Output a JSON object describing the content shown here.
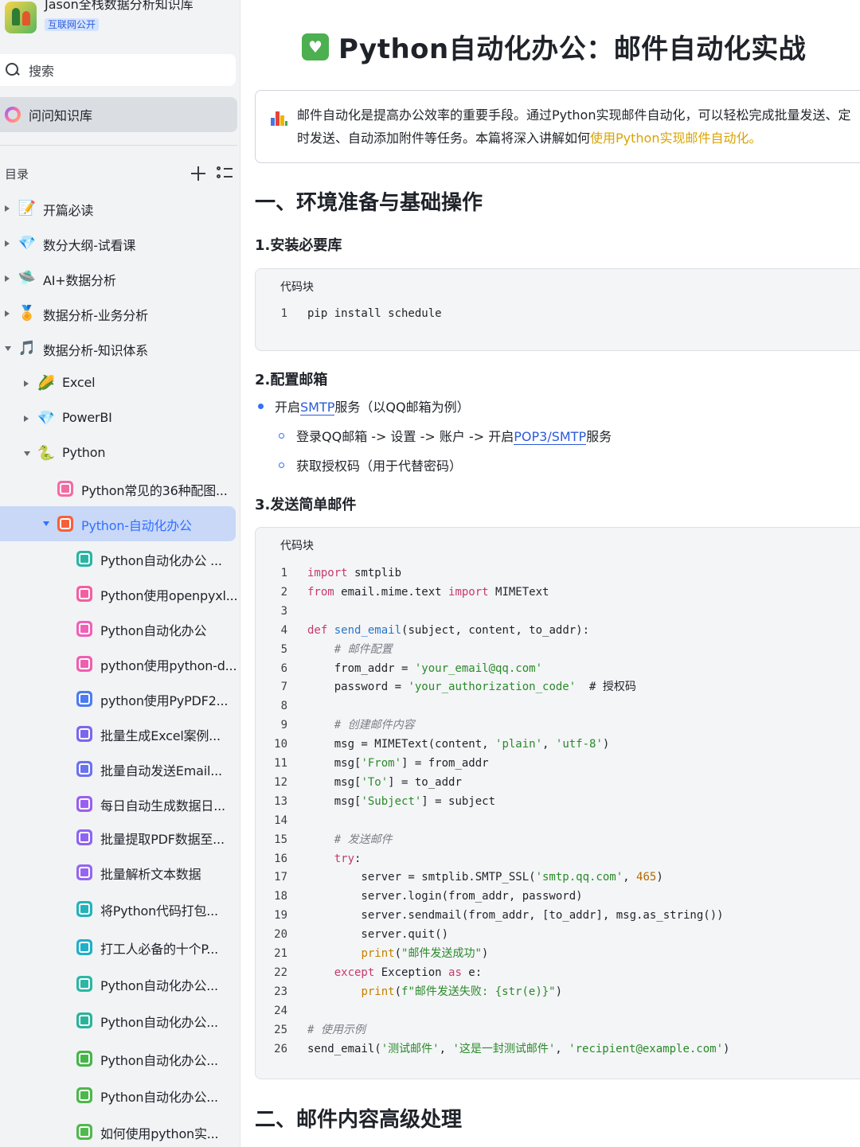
{
  "sidebar": {
    "brand": {
      "title": "Jason全栈数据分析知识库",
      "badge": "互联网公开"
    },
    "search": {
      "label": "搜索"
    },
    "ask": {
      "label": "问问知识库"
    },
    "toc": {
      "title": "目录",
      "items": [
        {
          "label": "开篇必读",
          "icon": "memo-icon",
          "glyph": "📝"
        },
        {
          "label": "数分大纲-试看课",
          "icon": "gem-icon",
          "glyph": "💎"
        },
        {
          "label": "AI+数据分析",
          "icon": "flying-saucer-icon",
          "glyph": "🛸"
        },
        {
          "label": "数据分析-业务分析",
          "icon": "medal-icon",
          "glyph": "🏅"
        },
        {
          "label": "数据分析-知识体系",
          "icon": "music-notes-icon",
          "glyph": "🎵"
        },
        {
          "label": "Excel",
          "icon": "corn-icon",
          "glyph": "🌽"
        },
        {
          "label": "PowerBI",
          "icon": "gem-icon",
          "glyph": "💎"
        },
        {
          "label": "Python",
          "icon": "snake-icon",
          "glyph": "🐍"
        },
        {
          "label": "Python常见的36种配图...",
          "icon": "doc-pink-icon",
          "color": "#f26ca4"
        },
        {
          "label": "Python-自动化办公",
          "icon": "doc-red-icon",
          "color": "#f5603a"
        },
        {
          "label": "Python自动化办公 ...",
          "icon": "doc-teal-icon",
          "color": "#27b6a4"
        },
        {
          "label": "Python使用openpyxl...",
          "icon": "doc-pink-icon",
          "color": "#f25fa0"
        },
        {
          "label": "Python自动化办公",
          "icon": "doc-pink-icon",
          "color": "#f060b8"
        },
        {
          "label": "python使用python-d...",
          "icon": "doc-pink-icon",
          "color": "#ee5fb0"
        },
        {
          "label": "python使用PyPDF2...",
          "icon": "doc-blue-icon",
          "color": "#4c7bf3"
        },
        {
          "label": "批量生成Excel案例...",
          "icon": "doc-purple-icon",
          "color": "#7a67ee"
        },
        {
          "label": "批量自动发送Email...",
          "icon": "doc-indigo-icon",
          "color": "#6a72f0"
        },
        {
          "label": "每日自动生成数据日...",
          "icon": "doc-violet-icon",
          "color": "#9a5ff0"
        },
        {
          "label": "批量提取PDF数据至...",
          "icon": "doc-violet-icon",
          "color": "#8f63f2"
        },
        {
          "label": "批量解析文本数据",
          "icon": "doc-violet-icon",
          "color": "#9566ef"
        },
        {
          "label": "将Python代码打包...",
          "icon": "doc-teal-icon",
          "color": "#22b3b8"
        },
        {
          "label": "打工人必备的十个P...",
          "icon": "doc-teal-icon",
          "color": "#1fb0c8"
        },
        {
          "label": "Python自动化办公...",
          "icon": "doc-teal-icon",
          "color": "#2bb6a6"
        },
        {
          "label": "Python自动化办公...",
          "icon": "doc-teal-icon",
          "color": "#29b49a"
        },
        {
          "label": "Python自动化办公...",
          "icon": "doc-green-icon",
          "color": "#45b649"
        },
        {
          "label": "Python自动化办公...",
          "icon": "doc-green-icon",
          "color": "#4cb84a"
        },
        {
          "label": "如何使用python实...",
          "icon": "doc-green-icon",
          "color": "#50b94d"
        }
      ]
    }
  },
  "main": {
    "title": "Python自动化办公：邮件自动化实战",
    "callout": {
      "text": "邮件自动化是提高办公效率的重要手段。通过Python实现邮件自动化，可以轻松完成批量发送、定时发送、自动添加附件等任务。本篇将深入讲解如何",
      "highlight": "使用Python实现邮件自动化。"
    },
    "section1": {
      "heading": "一、环境准备与基础操作",
      "sub1": "1.安装必要库",
      "code1_label": "代码块",
      "sub2": "2.配置邮箱",
      "bullet1_pre": "开启",
      "bullet1_link": "SMTP",
      "bullet1_post": "服务（以QQ邮箱为例）",
      "bullet2_pre": "登录QQ邮箱 -> 设置 -> 账户 -> 开启",
      "bullet2_link": "POP3/SMTP",
      "bullet2_post": "服务",
      "bullet3": "获取授权码（用于代替密码）",
      "sub3": "3.发送简单邮件",
      "code2_label": "代码块"
    },
    "section2": {
      "heading": "二、邮件内容高级处理"
    }
  },
  "code1": [
    {
      "n": "1",
      "t": "pip install schedule"
    }
  ],
  "code2": [
    {
      "n": "1",
      "t": "import smtplib"
    },
    {
      "n": "2",
      "t": "from email.mime.text import MIMEText"
    },
    {
      "n": "3",
      "t": ""
    },
    {
      "n": "4",
      "t": "def send_email(subject, content, to_addr):"
    },
    {
      "n": "5",
      "t": "    # 邮件配置"
    },
    {
      "n": "6",
      "t": "    from_addr = 'your_email@qq.com'"
    },
    {
      "n": "7",
      "t": "    password = 'your_authorization_code'  # 授权码"
    },
    {
      "n": "8",
      "t": ""
    },
    {
      "n": "9",
      "t": "    # 创建邮件内容"
    },
    {
      "n": "10",
      "t": "    msg = MIMEText(content, 'plain', 'utf-8')"
    },
    {
      "n": "11",
      "t": "    msg['From'] = from_addr"
    },
    {
      "n": "12",
      "t": "    msg['To'] = to_addr"
    },
    {
      "n": "13",
      "t": "    msg['Subject'] = subject"
    },
    {
      "n": "14",
      "t": ""
    },
    {
      "n": "15",
      "t": "    # 发送邮件"
    },
    {
      "n": "16",
      "t": "    try:"
    },
    {
      "n": "17",
      "t": "        server = smtplib.SMTP_SSL('smtp.qq.com', 465)"
    },
    {
      "n": "18",
      "t": "        server.login(from_addr, password)"
    },
    {
      "n": "19",
      "t": "        server.sendmail(from_addr, [to_addr], msg.as_string())"
    },
    {
      "n": "20",
      "t": "        server.quit()"
    },
    {
      "n": "21",
      "t": "        print(\"邮件发送成功\")"
    },
    {
      "n": "22",
      "t": "    except Exception as e:"
    },
    {
      "n": "23",
      "t": "        print(f\"邮件发送失败: {str(e)}\")"
    },
    {
      "n": "24",
      "t": ""
    },
    {
      "n": "25",
      "t": "# 使用示例"
    },
    {
      "n": "26",
      "t": "send_email('测试邮件', '这是一封测试邮件', 'recipient@example.com')"
    }
  ],
  "colors": {
    "accent": "#3370ff",
    "active_bg": "#c9d8f7",
    "highlight": "#d9a400"
  }
}
